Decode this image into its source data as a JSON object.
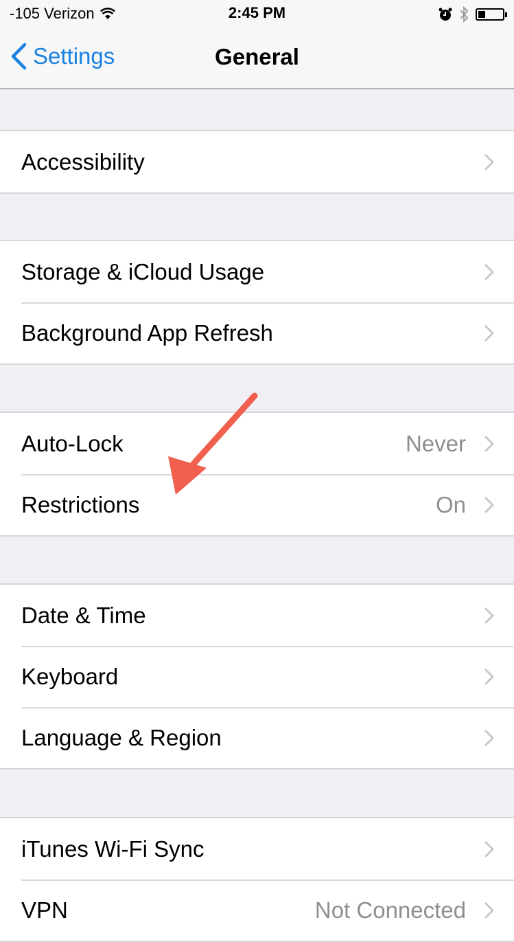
{
  "status_bar": {
    "signal": "-105",
    "carrier": "Verizon",
    "time": "2:45 PM",
    "battery_level": 0.3
  },
  "nav": {
    "back_label": "Settings",
    "title": "General"
  },
  "groups": [
    {
      "rows": [
        {
          "label": "Accessibility",
          "value": ""
        }
      ]
    },
    {
      "rows": [
        {
          "label": "Storage & iCloud Usage",
          "value": ""
        },
        {
          "label": "Background App Refresh",
          "value": ""
        }
      ]
    },
    {
      "rows": [
        {
          "label": "Auto-Lock",
          "value": "Never"
        },
        {
          "label": "Restrictions",
          "value": "On"
        }
      ]
    },
    {
      "rows": [
        {
          "label": "Date & Time",
          "value": ""
        },
        {
          "label": "Keyboard",
          "value": ""
        },
        {
          "label": "Language & Region",
          "value": ""
        }
      ]
    },
    {
      "rows": [
        {
          "label": "iTunes Wi-Fi Sync",
          "value": ""
        },
        {
          "label": "VPN",
          "value": "Not Connected"
        }
      ]
    }
  ],
  "annotation": {
    "type": "arrow",
    "color": "#f0604d",
    "points_to": "Restrictions"
  }
}
